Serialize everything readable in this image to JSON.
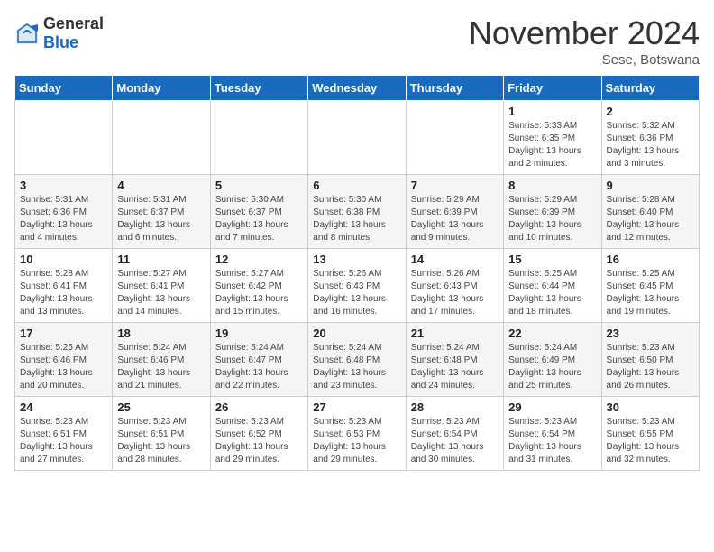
{
  "logo": {
    "general": "General",
    "blue": "Blue"
  },
  "title": "November 2024",
  "location": "Sese, Botswana",
  "days_of_week": [
    "Sunday",
    "Monday",
    "Tuesday",
    "Wednesday",
    "Thursday",
    "Friday",
    "Saturday"
  ],
  "weeks": [
    [
      {
        "day": "",
        "info": ""
      },
      {
        "day": "",
        "info": ""
      },
      {
        "day": "",
        "info": ""
      },
      {
        "day": "",
        "info": ""
      },
      {
        "day": "",
        "info": ""
      },
      {
        "day": "1",
        "info": "Sunrise: 5:33 AM\nSunset: 6:35 PM\nDaylight: 13 hours and 2 minutes."
      },
      {
        "day": "2",
        "info": "Sunrise: 5:32 AM\nSunset: 6:36 PM\nDaylight: 13 hours and 3 minutes."
      }
    ],
    [
      {
        "day": "3",
        "info": "Sunrise: 5:31 AM\nSunset: 6:36 PM\nDaylight: 13 hours and 4 minutes."
      },
      {
        "day": "4",
        "info": "Sunrise: 5:31 AM\nSunset: 6:37 PM\nDaylight: 13 hours and 6 minutes."
      },
      {
        "day": "5",
        "info": "Sunrise: 5:30 AM\nSunset: 6:37 PM\nDaylight: 13 hours and 7 minutes."
      },
      {
        "day": "6",
        "info": "Sunrise: 5:30 AM\nSunset: 6:38 PM\nDaylight: 13 hours and 8 minutes."
      },
      {
        "day": "7",
        "info": "Sunrise: 5:29 AM\nSunset: 6:39 PM\nDaylight: 13 hours and 9 minutes."
      },
      {
        "day": "8",
        "info": "Sunrise: 5:29 AM\nSunset: 6:39 PM\nDaylight: 13 hours and 10 minutes."
      },
      {
        "day": "9",
        "info": "Sunrise: 5:28 AM\nSunset: 6:40 PM\nDaylight: 13 hours and 12 minutes."
      }
    ],
    [
      {
        "day": "10",
        "info": "Sunrise: 5:28 AM\nSunset: 6:41 PM\nDaylight: 13 hours and 13 minutes."
      },
      {
        "day": "11",
        "info": "Sunrise: 5:27 AM\nSunset: 6:41 PM\nDaylight: 13 hours and 14 minutes."
      },
      {
        "day": "12",
        "info": "Sunrise: 5:27 AM\nSunset: 6:42 PM\nDaylight: 13 hours and 15 minutes."
      },
      {
        "day": "13",
        "info": "Sunrise: 5:26 AM\nSunset: 6:43 PM\nDaylight: 13 hours and 16 minutes."
      },
      {
        "day": "14",
        "info": "Sunrise: 5:26 AM\nSunset: 6:43 PM\nDaylight: 13 hours and 17 minutes."
      },
      {
        "day": "15",
        "info": "Sunrise: 5:25 AM\nSunset: 6:44 PM\nDaylight: 13 hours and 18 minutes."
      },
      {
        "day": "16",
        "info": "Sunrise: 5:25 AM\nSunset: 6:45 PM\nDaylight: 13 hours and 19 minutes."
      }
    ],
    [
      {
        "day": "17",
        "info": "Sunrise: 5:25 AM\nSunset: 6:46 PM\nDaylight: 13 hours and 20 minutes."
      },
      {
        "day": "18",
        "info": "Sunrise: 5:24 AM\nSunset: 6:46 PM\nDaylight: 13 hours and 21 minutes."
      },
      {
        "day": "19",
        "info": "Sunrise: 5:24 AM\nSunset: 6:47 PM\nDaylight: 13 hours and 22 minutes."
      },
      {
        "day": "20",
        "info": "Sunrise: 5:24 AM\nSunset: 6:48 PM\nDaylight: 13 hours and 23 minutes."
      },
      {
        "day": "21",
        "info": "Sunrise: 5:24 AM\nSunset: 6:48 PM\nDaylight: 13 hours and 24 minutes."
      },
      {
        "day": "22",
        "info": "Sunrise: 5:24 AM\nSunset: 6:49 PM\nDaylight: 13 hours and 25 minutes."
      },
      {
        "day": "23",
        "info": "Sunrise: 5:23 AM\nSunset: 6:50 PM\nDaylight: 13 hours and 26 minutes."
      }
    ],
    [
      {
        "day": "24",
        "info": "Sunrise: 5:23 AM\nSunset: 6:51 PM\nDaylight: 13 hours and 27 minutes."
      },
      {
        "day": "25",
        "info": "Sunrise: 5:23 AM\nSunset: 6:51 PM\nDaylight: 13 hours and 28 minutes."
      },
      {
        "day": "26",
        "info": "Sunrise: 5:23 AM\nSunset: 6:52 PM\nDaylight: 13 hours and 29 minutes."
      },
      {
        "day": "27",
        "info": "Sunrise: 5:23 AM\nSunset: 6:53 PM\nDaylight: 13 hours and 29 minutes."
      },
      {
        "day": "28",
        "info": "Sunrise: 5:23 AM\nSunset: 6:54 PM\nDaylight: 13 hours and 30 minutes."
      },
      {
        "day": "29",
        "info": "Sunrise: 5:23 AM\nSunset: 6:54 PM\nDaylight: 13 hours and 31 minutes."
      },
      {
        "day": "30",
        "info": "Sunrise: 5:23 AM\nSunset: 6:55 PM\nDaylight: 13 hours and 32 minutes."
      }
    ]
  ]
}
